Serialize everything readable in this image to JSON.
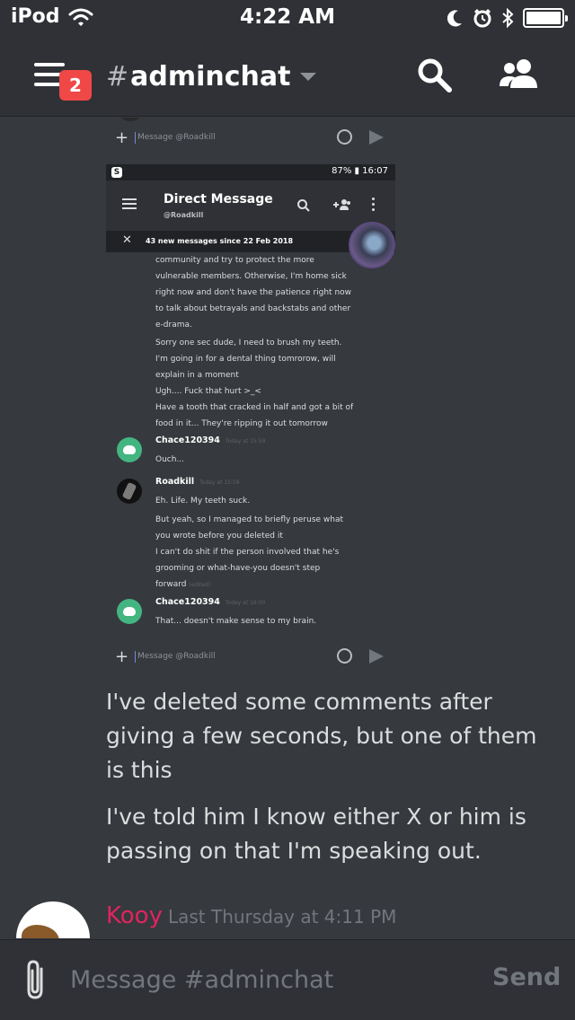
{
  "status_bar": {
    "carrier": "iPod",
    "time": "4:22 AM"
  },
  "header": {
    "menu_badge": "2",
    "channel_hash": "#",
    "channel_name": "adminchat"
  },
  "embedded_screenshot": {
    "input_placeholder": "Message @Roadkill",
    "status_right": "87% ▮ 16:07",
    "dm_title": "Direct Message",
    "dm_subtitle": "@Roadkill",
    "new_messages_banner": "43 new messages since 22 Feb 2018",
    "messages": [
      {
        "line": "community and try to protect the more"
      },
      {
        "line": "vulnerable members. Otherwise, I'm home sick"
      },
      {
        "line": "right now and don't have the patience right now"
      },
      {
        "line": "to talk about betrayals and backstabs and other"
      },
      {
        "line": "e-drama."
      },
      {
        "line": "Sorry one sec dude, I need to brush my teeth."
      },
      {
        "line": "I'm going in for a dental thing tomrorow, will"
      },
      {
        "line": "explain in a moment"
      },
      {
        "line": "Ugh.... Fuck that hurt >_<"
      },
      {
        "line": "Have a tooth that cracked in half and got a bit of"
      },
      {
        "line": "food in it... They're ripping it out tomorrow"
      }
    ],
    "chace_1": {
      "author": "Chace120394",
      "timestamp": "Today at 15:59",
      "text": "Ouch..."
    },
    "roadkill": {
      "author": "Roadkill",
      "timestamp": "Today at 15:59",
      "lines": [
        "Eh. Life. My teeth suck.",
        "But yeah, so I managed to briefly peruse what",
        "you wrote before you deleted it",
        "I can't do shit if the person involved that he's",
        "grooming or what-have-you doesn't step",
        "forward"
      ],
      "edited": "(edited)"
    },
    "chace_2": {
      "author": "Chace120394",
      "timestamp": "Today at 16:00",
      "text": "That... doesn't make sense to my brain."
    }
  },
  "message_body": {
    "paragraph_1": "I've deleted some comments after giving a few seconds, but one of them is this",
    "paragraph_2": "I've told him I know either X or him is passing on that I'm speaking out."
  },
  "next_message": {
    "author": "Kooy",
    "timestamp": "Last Thursday at 4:11 PM"
  },
  "composer": {
    "placeholder": "Message #adminchat",
    "send_label": "Send"
  },
  "colors": {
    "background": "#36393e",
    "header": "#2f3136",
    "badge": "#f04747",
    "author_kooy": "#e0245e",
    "discord_green": "#43b581"
  }
}
